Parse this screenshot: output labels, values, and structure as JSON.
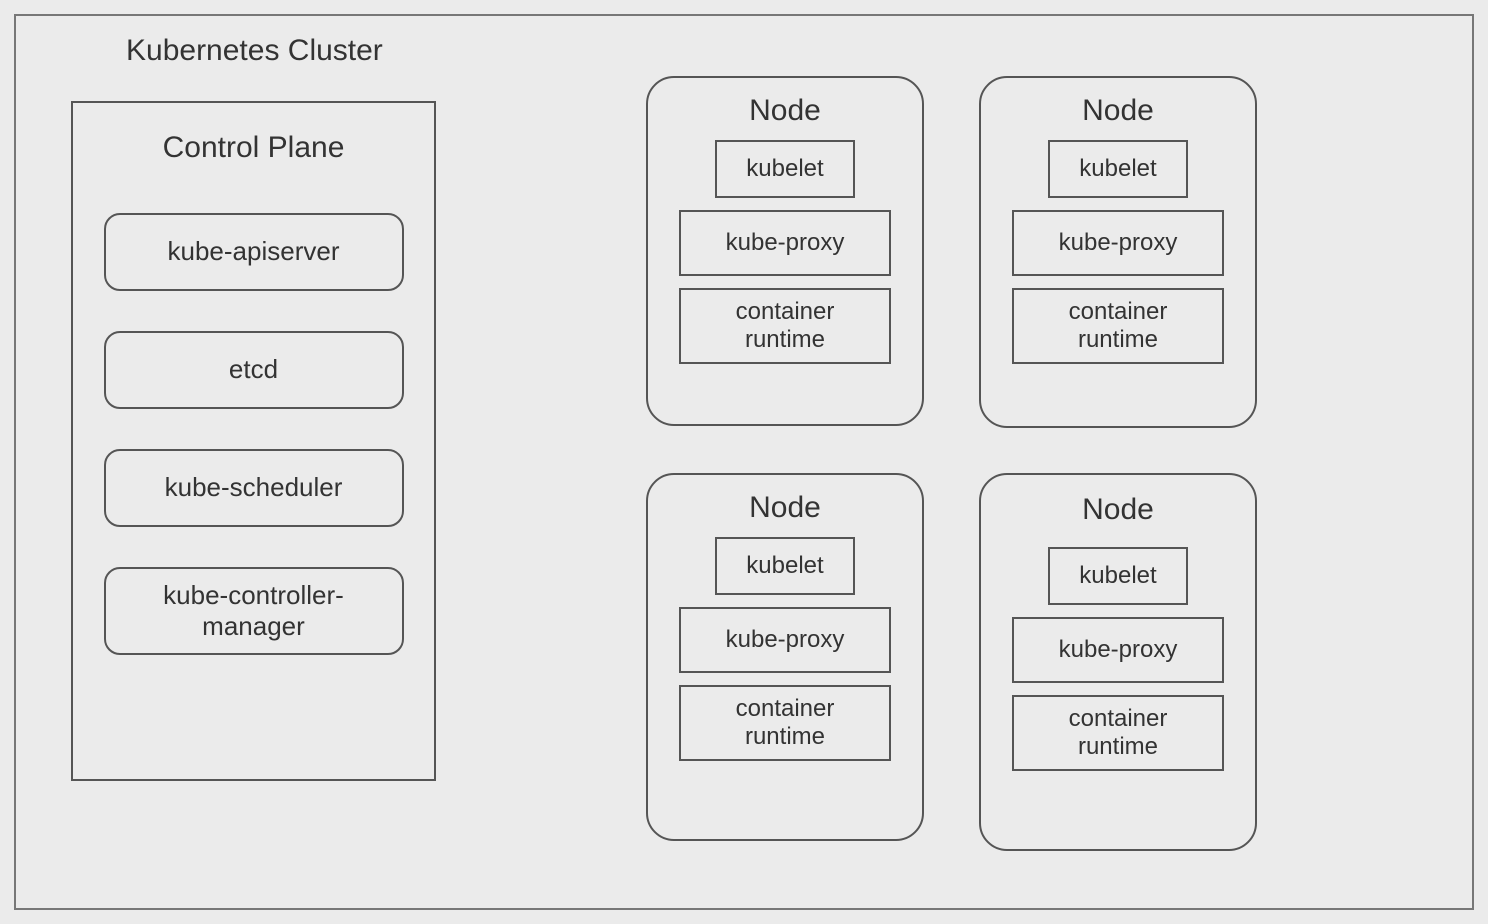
{
  "cluster": {
    "title": "Kubernetes Cluster"
  },
  "control_plane": {
    "title": "Control Plane",
    "items": [
      "kube-apiserver",
      "etcd",
      "kube-scheduler",
      "kube-controller-\nmanager"
    ]
  },
  "node": {
    "title": "Node",
    "components": {
      "kubelet": "kubelet",
      "proxy": "kube-proxy",
      "runtime": "container\nruntime"
    }
  },
  "nodes_count": 4
}
